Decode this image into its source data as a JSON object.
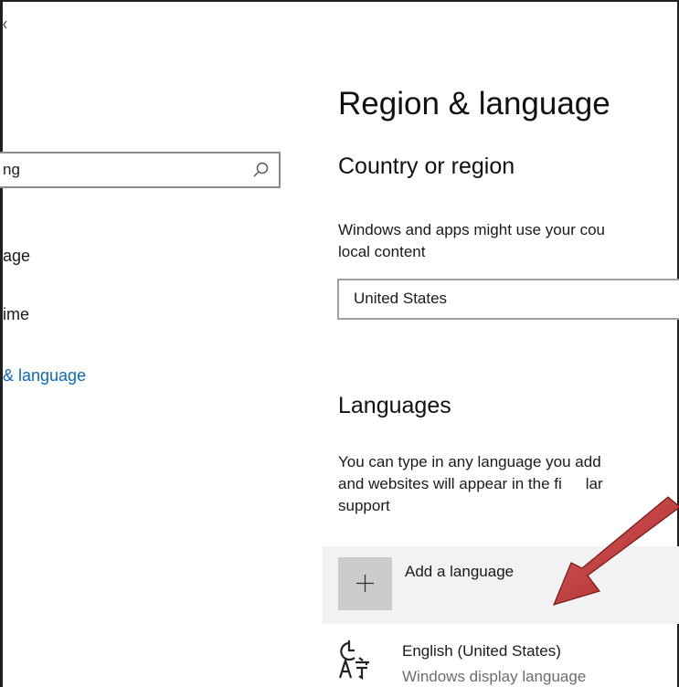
{
  "sidebar": {
    "search_value": "ng",
    "items": [
      {
        "label": "age"
      },
      {
        "label": "ime"
      },
      {
        "label": "& language",
        "selected": true
      }
    ]
  },
  "main": {
    "title": "Region & language",
    "country": {
      "heading": "Country or region",
      "description_line1": "Windows and apps might use your cou",
      "description_line2": "local content",
      "selected_value": "United States"
    },
    "languages": {
      "heading": "Languages",
      "description_line1": "You can type in any language you add",
      "description_line2": "and websites will appear in the fi",
      "description_line2_tail": "lar",
      "description_line3": "support",
      "add_label": "Add a language",
      "installed": [
        {
          "name": "English (United States)",
          "subtitle": "Windows display language"
        }
      ]
    }
  },
  "colors": {
    "accent": "#0a68c6",
    "arrow": "#c0393b",
    "add_row_bg": "#f2f2f2",
    "plus_tile_bg": "#cccccc"
  },
  "icons": [
    "search-icon",
    "plus-icon",
    "language-icon",
    "red-arrow-annotation"
  ]
}
